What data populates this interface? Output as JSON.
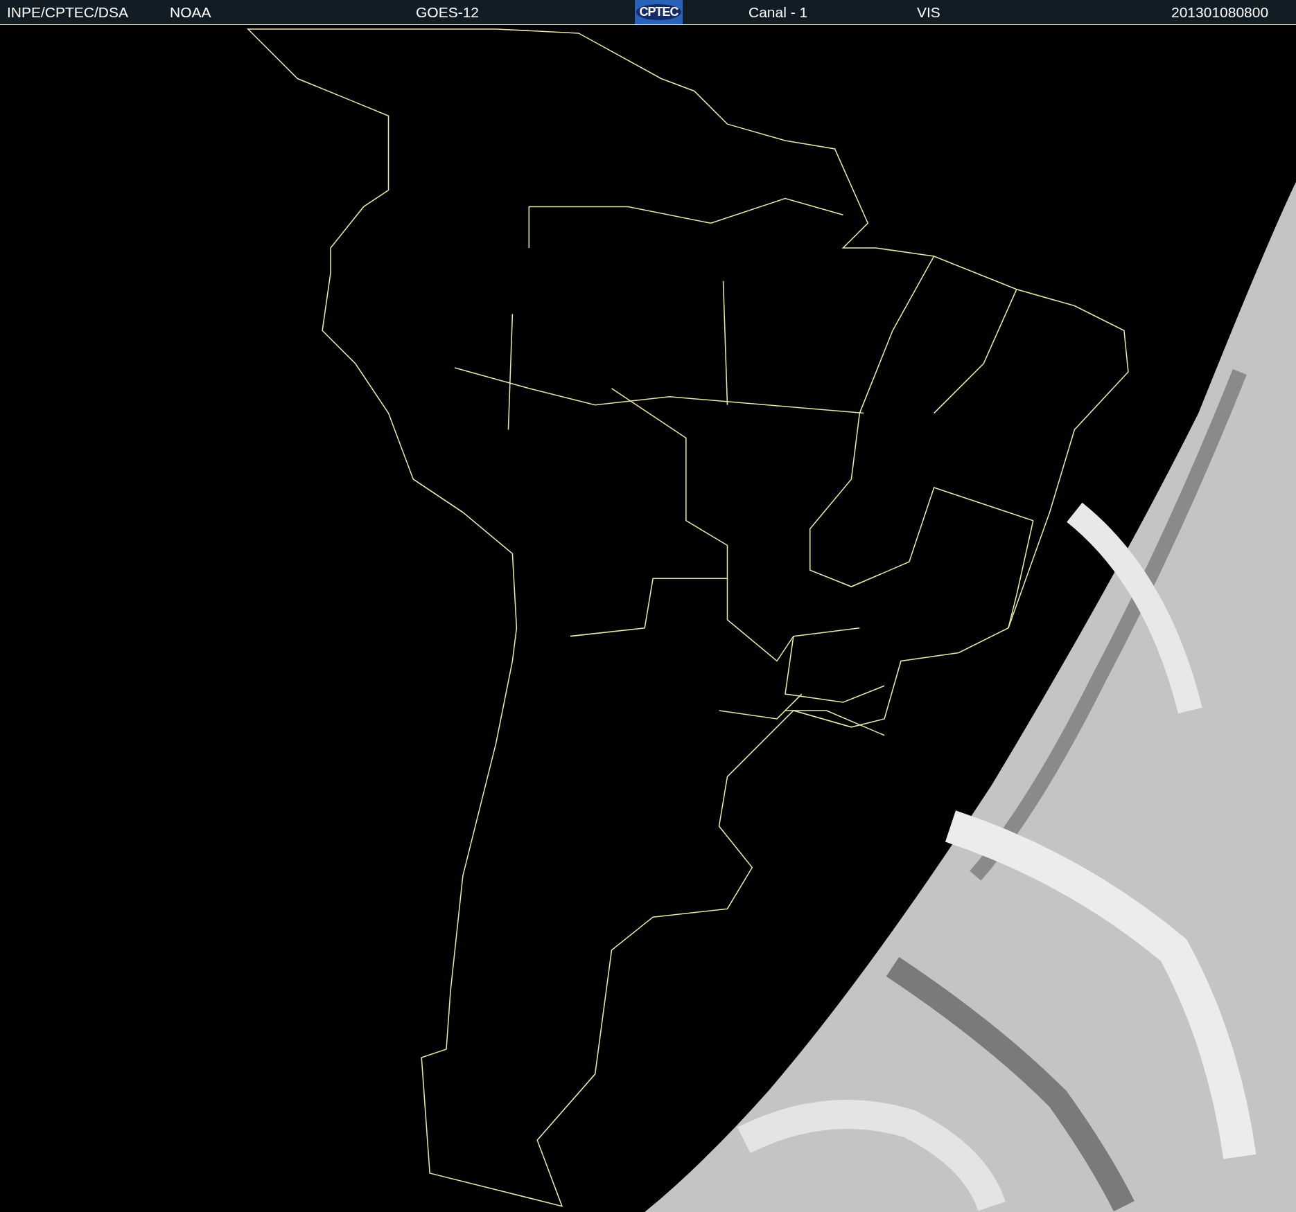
{
  "header": {
    "source": "INPE/CPTEC/DSA",
    "agency": "NOAA",
    "satellite": "GOES-12",
    "logo": "CPTEC",
    "channel": "Canal - 1",
    "band": "VIS",
    "timestamp": "201301080800"
  }
}
